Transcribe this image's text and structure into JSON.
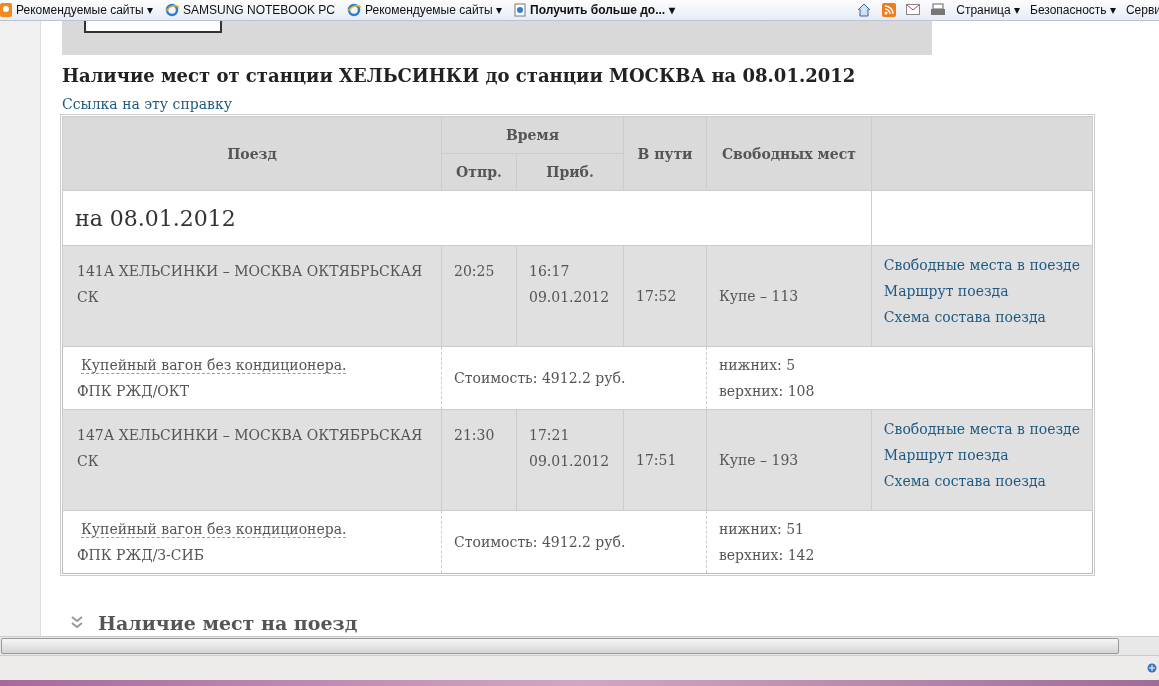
{
  "toolbar": {
    "favorites": [
      {
        "label": "Рекомендуемые сайты ▾",
        "kind": "bulb"
      },
      {
        "label": "SAMSUNG NOTEBOOK PC",
        "kind": "ie"
      },
      {
        "label": "Рекомендуемые сайты ▾",
        "kind": "ie"
      },
      {
        "label": "Получить больше до... ▾",
        "kind": "page"
      }
    ],
    "commands": [
      "Страница ▾",
      "Безопасность ▾",
      "Серви"
    ]
  },
  "title": "Наличие мест от станции ХЕЛЬСИНКИ до станции МОСКВА на 08.01.2012",
  "link": "Ссылка на эту справку",
  "table": {
    "columns": {
      "train": "Поезд",
      "time": "Время",
      "depart": "Отпр.",
      "arrive": "Приб.",
      "duration": "В пути",
      "free": "Свободных мест"
    },
    "date": "на 08.01.2012",
    "trains": [
      {
        "name": "141А ХЕЛЬСИНКИ – МОСКВА ОКТЯБРЬСКАЯ СК",
        "depart": "20:25",
        "arrive_time": "16:17",
        "arrive_date": "09.01.2012",
        "duration": "17:52",
        "free": "Купе – 113",
        "links": [
          "Свободные места в поезде",
          "Маршрут поезда",
          "Схема состава поезда"
        ],
        "car": "Купейный вагон без кондиционера.",
        "carrier": "ФПК РЖД/ОКТ",
        "price": "Стоимость: 4912.2 руб.",
        "lower": "нижних: 5",
        "upper": "верхних: 108"
      },
      {
        "name": "147А ХЕЛЬСИНКИ – МОСКВА ОКТЯБРЬСКАЯ СК",
        "depart": "21:30",
        "arrive_time": "17:21",
        "arrive_date": "09.01.2012",
        "duration": "17:51",
        "free": "Купе – 193",
        "links": [
          "Свободные места в поезде",
          "Маршрут поезда",
          "Схема состава поезда"
        ],
        "car": "Купейный вагон без кондиционера.",
        "carrier": "ФПК РЖД/З-СИБ",
        "price": "Стоимость: 4912.2 руб.",
        "lower": "нижних: 51",
        "upper": "верхних: 142"
      }
    ]
  },
  "section": "Наличие мест на поезд"
}
